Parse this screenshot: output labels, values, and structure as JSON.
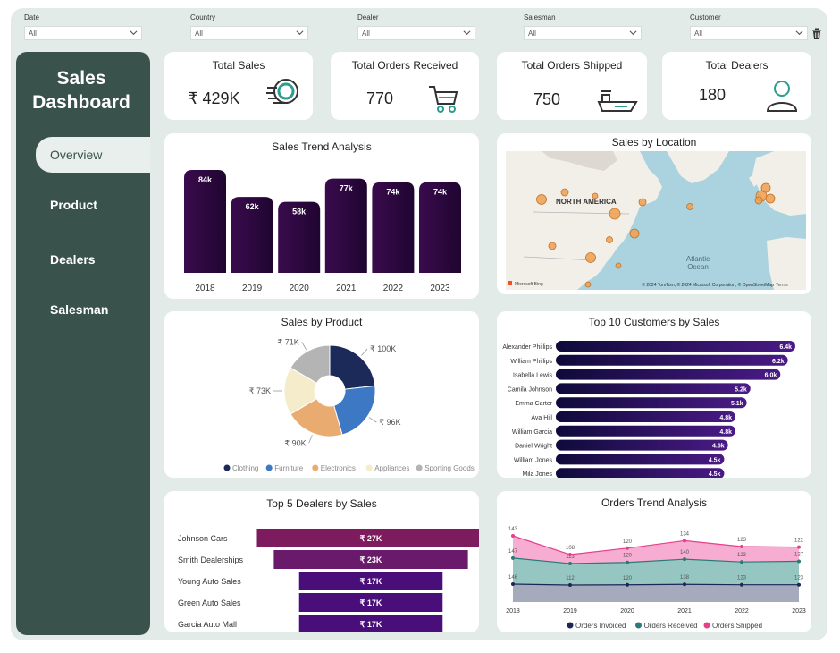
{
  "filters": [
    {
      "label": "Date",
      "value": "All"
    },
    {
      "label": "Country",
      "value": "All"
    },
    {
      "label": "Dealer",
      "value": "All"
    },
    {
      "label": "Salesman",
      "value": "All"
    },
    {
      "label": "Customer",
      "value": "All"
    }
  ],
  "sidebar": {
    "title_line1": "Sales",
    "title_line2": "Dashboard",
    "items": [
      {
        "label": "Overview",
        "active": true
      },
      {
        "label": "Product"
      },
      {
        "label": "Dealers"
      },
      {
        "label": "Salesman"
      }
    ]
  },
  "kpis": {
    "total_sales": {
      "title": "Total Sales",
      "value": "₹ 429K",
      "icon": "coins-icon"
    },
    "orders_received": {
      "title": "Total Orders Received",
      "value": "770",
      "icon": "cart-icon"
    },
    "orders_shipped": {
      "title": "Total Orders Shipped",
      "value": "750",
      "icon": "ship-icon"
    },
    "dealers": {
      "title": "Total Dealers",
      "value": "180",
      "icon": "person-icon"
    }
  },
  "colors": {
    "sidebar": "#3a524c",
    "background": "#e3ebe8",
    "bar_dark": "#2a0838",
    "accent_teal": "#2a9d8f"
  },
  "chart_data": [
    {
      "type": "bar",
      "title": "Sales Trend Analysis",
      "categories": [
        "2018",
        "2019",
        "2020",
        "2021",
        "2022",
        "2023"
      ],
      "values": [
        84,
        62,
        58,
        77,
        74,
        74
      ],
      "labels": [
        "84k",
        "62k",
        "58k",
        "77k",
        "74k",
        "74k"
      ]
    },
    {
      "type": "map",
      "title": "Sales by Location",
      "labels": {
        "continent": "NORTH AMERICA",
        "ocean": "Atlantic Ocean",
        "ocean_line1": "Atlantic",
        "ocean_line2": "Ocean",
        "logo": "Microsoft Bing",
        "attribution": "© 2024 TomTom, © 2024 Microsoft Corporation, © OpenStreetMap",
        "terms": "Terms"
      }
    },
    {
      "type": "pie",
      "title": "Sales by Product",
      "categories": [
        "Clothing",
        "Furniture",
        "Electronics",
        "Appliances",
        "Sporting Goods"
      ],
      "values": [
        100,
        96,
        90,
        73,
        71
      ],
      "labels": [
        "₹ 100K",
        "₹ 96K",
        "₹ 90K",
        "₹ 73K",
        "₹ 71K"
      ],
      "colors": [
        "#1b2a59",
        "#3c78c3",
        "#e9ab6f",
        "#f5eccb",
        "#b4b4b4"
      ],
      "legend": "bottom"
    },
    {
      "type": "bar",
      "orientation": "horizontal",
      "title": "Top 10 Customers by Sales",
      "categories": [
        "Alexander Phillips",
        "William Phillips",
        "Isabella Lewis",
        "Camila Johnson",
        "Emma Carter",
        "Ava Hill",
        "William Garcia",
        "Daniel Wright",
        "William Jones",
        "Mila Jones"
      ],
      "values": [
        6.4,
        6.2,
        6.0,
        5.2,
        5.1,
        4.8,
        4.8,
        4.6,
        4.5,
        4.5
      ],
      "labels": [
        "6.4k",
        "6.2k",
        "6.0k",
        "5.2k",
        "5.1k",
        "4.8k",
        "4.8k",
        "4.6k",
        "4.5k",
        "4.5k"
      ]
    },
    {
      "type": "bar",
      "orientation": "horizontal",
      "title": "Top 5 Dealers by Sales",
      "categories": [
        "Johnson Cars",
        "Smith Dealerships",
        "Young Auto Sales",
        "Green Auto Sales",
        "Garcia Auto Mall"
      ],
      "values": [
        27,
        23,
        17,
        17,
        17
      ],
      "labels": [
        "₹ 27K",
        "₹ 23K",
        "₹ 17K",
        "₹ 17K",
        "₹ 17K"
      ],
      "colors": [
        "#7d1b5e",
        "#6a1a6a",
        "#4a0e7a",
        "#4a0e7a",
        "#4a0e7a"
      ]
    },
    {
      "type": "area",
      "title": "Orders Trend Analysis",
      "x": [
        "2018",
        "2019",
        "2020",
        "2021",
        "2022",
        "2023"
      ],
      "series": [
        {
          "name": "Orders Invoiced",
          "values": [
            146,
            112,
            120,
            138,
            123,
            123
          ],
          "color": "#1d2656"
        },
        {
          "name": "Orders Received",
          "values": [
            147,
            113,
            120,
            140,
            123,
            127
          ],
          "color": "#2a7a78"
        },
        {
          "name": "Orders Shipped",
          "values": [
            143,
            108,
            120,
            134,
            123,
            122
          ],
          "color": "#e83e8c"
        }
      ],
      "legend": "bottom"
    }
  ]
}
